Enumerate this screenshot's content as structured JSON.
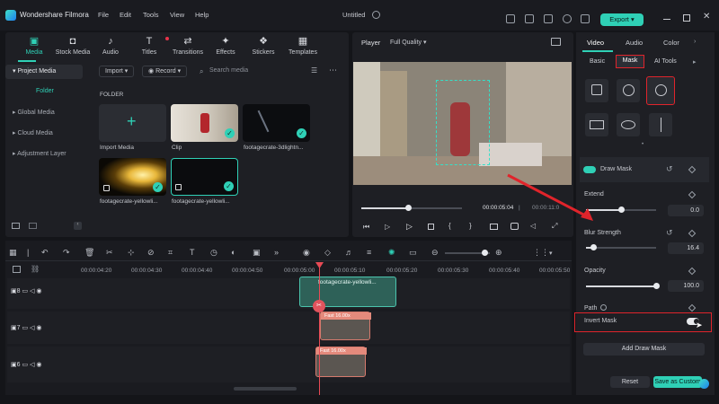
{
  "app": {
    "name": "Wondershare Filmora",
    "project_title": "Untitled"
  },
  "menu": [
    "File",
    "Edit",
    "Tools",
    "View",
    "Help"
  ],
  "export_label": "Export",
  "toolbar": [
    {
      "label": "Media",
      "icon": "media-icon"
    },
    {
      "label": "Stock Media",
      "icon": "stock-media-icon"
    },
    {
      "label": "Audio",
      "icon": "audio-icon"
    },
    {
      "label": "Titles",
      "icon": "titles-icon"
    },
    {
      "label": "Transitions",
      "icon": "transitions-icon"
    },
    {
      "label": "Effects",
      "icon": "effects-icon"
    },
    {
      "label": "Stickers",
      "icon": "stickers-icon"
    },
    {
      "label": "Templates",
      "icon": "templates-icon"
    }
  ],
  "sidebar": {
    "items": [
      "Project Media",
      "Folder",
      "Global Media",
      "Cloud Media",
      "Adjustment Layer"
    ]
  },
  "media": {
    "import_label": "Import",
    "record_label": "Record",
    "search_placeholder": "Search media",
    "folder_label": "FOLDER",
    "items": [
      "Import Media",
      "Clip",
      "footagecrate-3dlightn...",
      "footagecrate-yellowli...",
      "footagecrate-yellowli..."
    ]
  },
  "player": {
    "label": "Player",
    "quality": "Full Quality",
    "current_time": "00:00:05:04",
    "total_time": "00:00:11:0",
    "progress": 0.45
  },
  "right_panel": {
    "tabs": [
      "Video",
      "Audio",
      "Color"
    ],
    "subtabs": [
      "Basic",
      "Mask",
      "AI Tools"
    ],
    "draw_mask_label": "Draw Mask",
    "extend": {
      "label": "Extend",
      "value": "0.0",
      "level": 0.5
    },
    "blur": {
      "label": "Blur Strength",
      "value": "16.4",
      "level": 0.1
    },
    "opacity": {
      "label": "Opacity",
      "value": "100.0",
      "level": 1.0
    },
    "path_label": "Path",
    "invert_mask_label": "Invert Mask",
    "add_draw_mask_label": "Add Draw Mask",
    "reset_label": "Reset",
    "save_custom_label": "Save as Custom"
  },
  "timeline": {
    "ruler": [
      "00:00:04:20",
      "00:00:04:30",
      "00:00:04:40",
      "00:00:04:50",
      "00:00:05:00",
      "00:00:05:10",
      "00:00:05:20",
      "00:00:05:30",
      "00:00:05:40",
      "00:00:05:50"
    ],
    "tracks": [
      "8",
      "7",
      "6"
    ],
    "clip_top_label": "footagecrate-yellowli...",
    "clip_speed_label": "Fast 16.00x"
  },
  "colors": {
    "accent": "#2fd0b6",
    "highlight": "#e0242b",
    "playhead": "#e84a55"
  }
}
